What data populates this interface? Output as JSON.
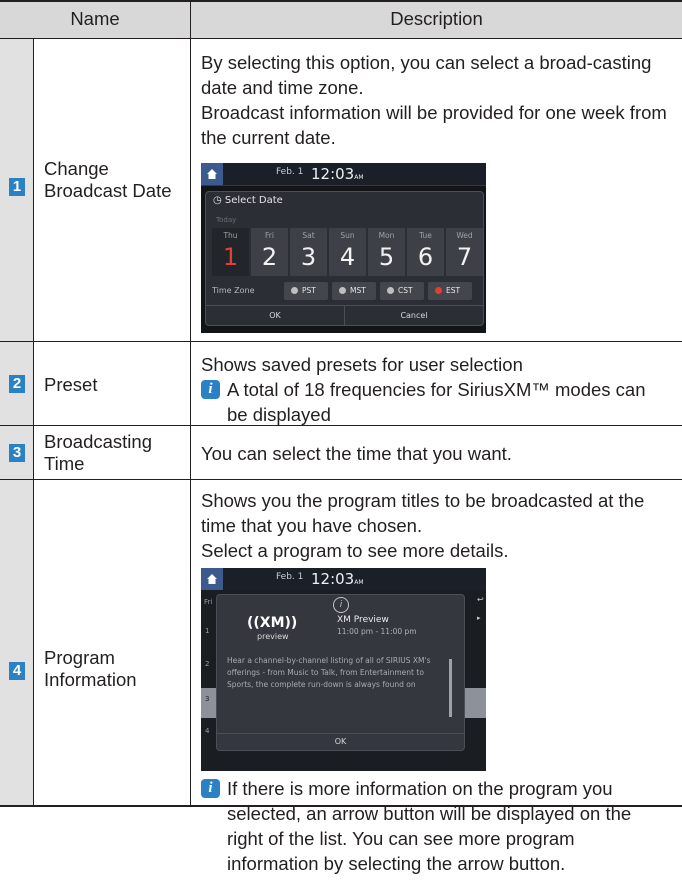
{
  "header": {
    "name": "Name",
    "description": "Description"
  },
  "rows": [
    {
      "number": "1",
      "name": "Change Broadcast Date",
      "desc": [
        "By selecting this option, you can select a broad-casting date and time zone.",
        "Broadcast information will be provided for one week from the current date."
      ]
    },
    {
      "number": "2",
      "name": "Preset",
      "desc": [
        "Shows saved presets for user selection"
      ],
      "note": "A total of 18 frequencies for SiriusXM™ modes can be displayed"
    },
    {
      "number": "3",
      "name": "Broadcasting Time",
      "desc": [
        "You can select the time that you want."
      ]
    },
    {
      "number": "4",
      "name": "Program Information",
      "desc": [
        "Shows you the program titles to be broadcasted at the time that you have chosen.",
        "Select a program to see more details."
      ],
      "note": "If there is more information on the program you selected, an arrow button will be displayed on the right of the list. You can see more program information by selecting the arrow button."
    }
  ],
  "screen1": {
    "date": "Feb.  1",
    "time": "12:03",
    "ampm": "AM",
    "dialog_title": "Select Date",
    "today": "Today",
    "days": [
      {
        "name": "Thu",
        "num": "1"
      },
      {
        "name": "Fri",
        "num": "2"
      },
      {
        "name": "Sat",
        "num": "3"
      },
      {
        "name": "Sun",
        "num": "4"
      },
      {
        "name": "Mon",
        "num": "5"
      },
      {
        "name": "Tue",
        "num": "6"
      },
      {
        "name": "Wed",
        "num": "7"
      }
    ],
    "tz_label": "Time Zone",
    "zones": [
      "PST",
      "MST",
      "CST",
      "EST"
    ],
    "ok": "OK",
    "cancel": "Cancel"
  },
  "screen2": {
    "date": "Feb.  1",
    "time": "12:03",
    "ampm": "AM",
    "list_tab": "Fri",
    "row_numbers": [
      "1",
      "2",
      "3",
      "4"
    ],
    "logo": "((XM))",
    "logo_sub": "preview",
    "program_title": "XM Preview",
    "program_time": "11:00 pm - 11:00 pm",
    "program_body": "Hear a channel-by-channel listing of all of SIRIUS XM's offerings - from Music to Talk, from Entertainment to Sports, the complete run-down is always found on",
    "ok": "OK"
  },
  "colors": {
    "badge": "#2a82c4",
    "selected_day": "#e24032"
  }
}
